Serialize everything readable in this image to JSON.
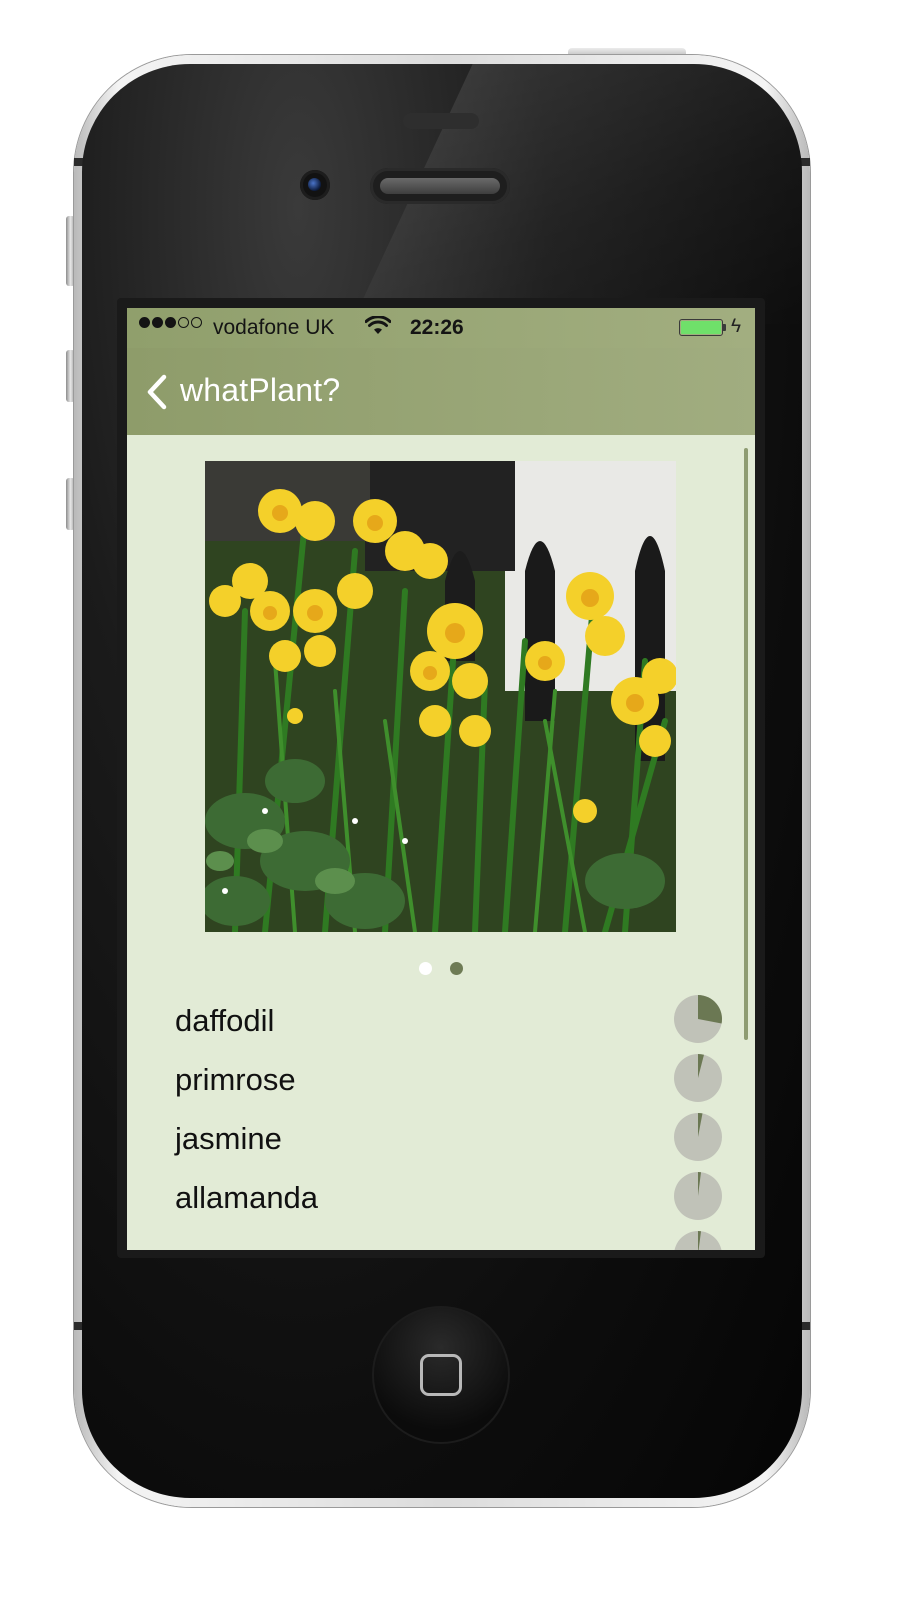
{
  "status_bar": {
    "signal_total": 5,
    "signal_filled": 3,
    "carrier": "vodafone UK",
    "time": "22:26",
    "battery_level": 1.0
  },
  "nav_bar": {
    "title": "whatPlant?",
    "back_icon": "chevron-left-icon"
  },
  "gallery": {
    "page_count": 2,
    "current_page": 1
  },
  "results": [
    {
      "name": "daffodil",
      "confidence": 0.28
    },
    {
      "name": "primrose",
      "confidence": 0.04
    },
    {
      "name": "jasmine",
      "confidence": 0.03
    },
    {
      "name": "allamanda",
      "confidence": 0.02
    },
    {
      "name": "",
      "confidence": 0.02
    }
  ],
  "colors": {
    "nav_bar": "#97a474",
    "screen_background": "#e2ebd6",
    "pie_track": "#c0c2b8",
    "pie_fill": "#6b7853",
    "pager_active": "#ffffff",
    "pager_inactive": "#6e7b55",
    "battery": "#6fe06a"
  }
}
